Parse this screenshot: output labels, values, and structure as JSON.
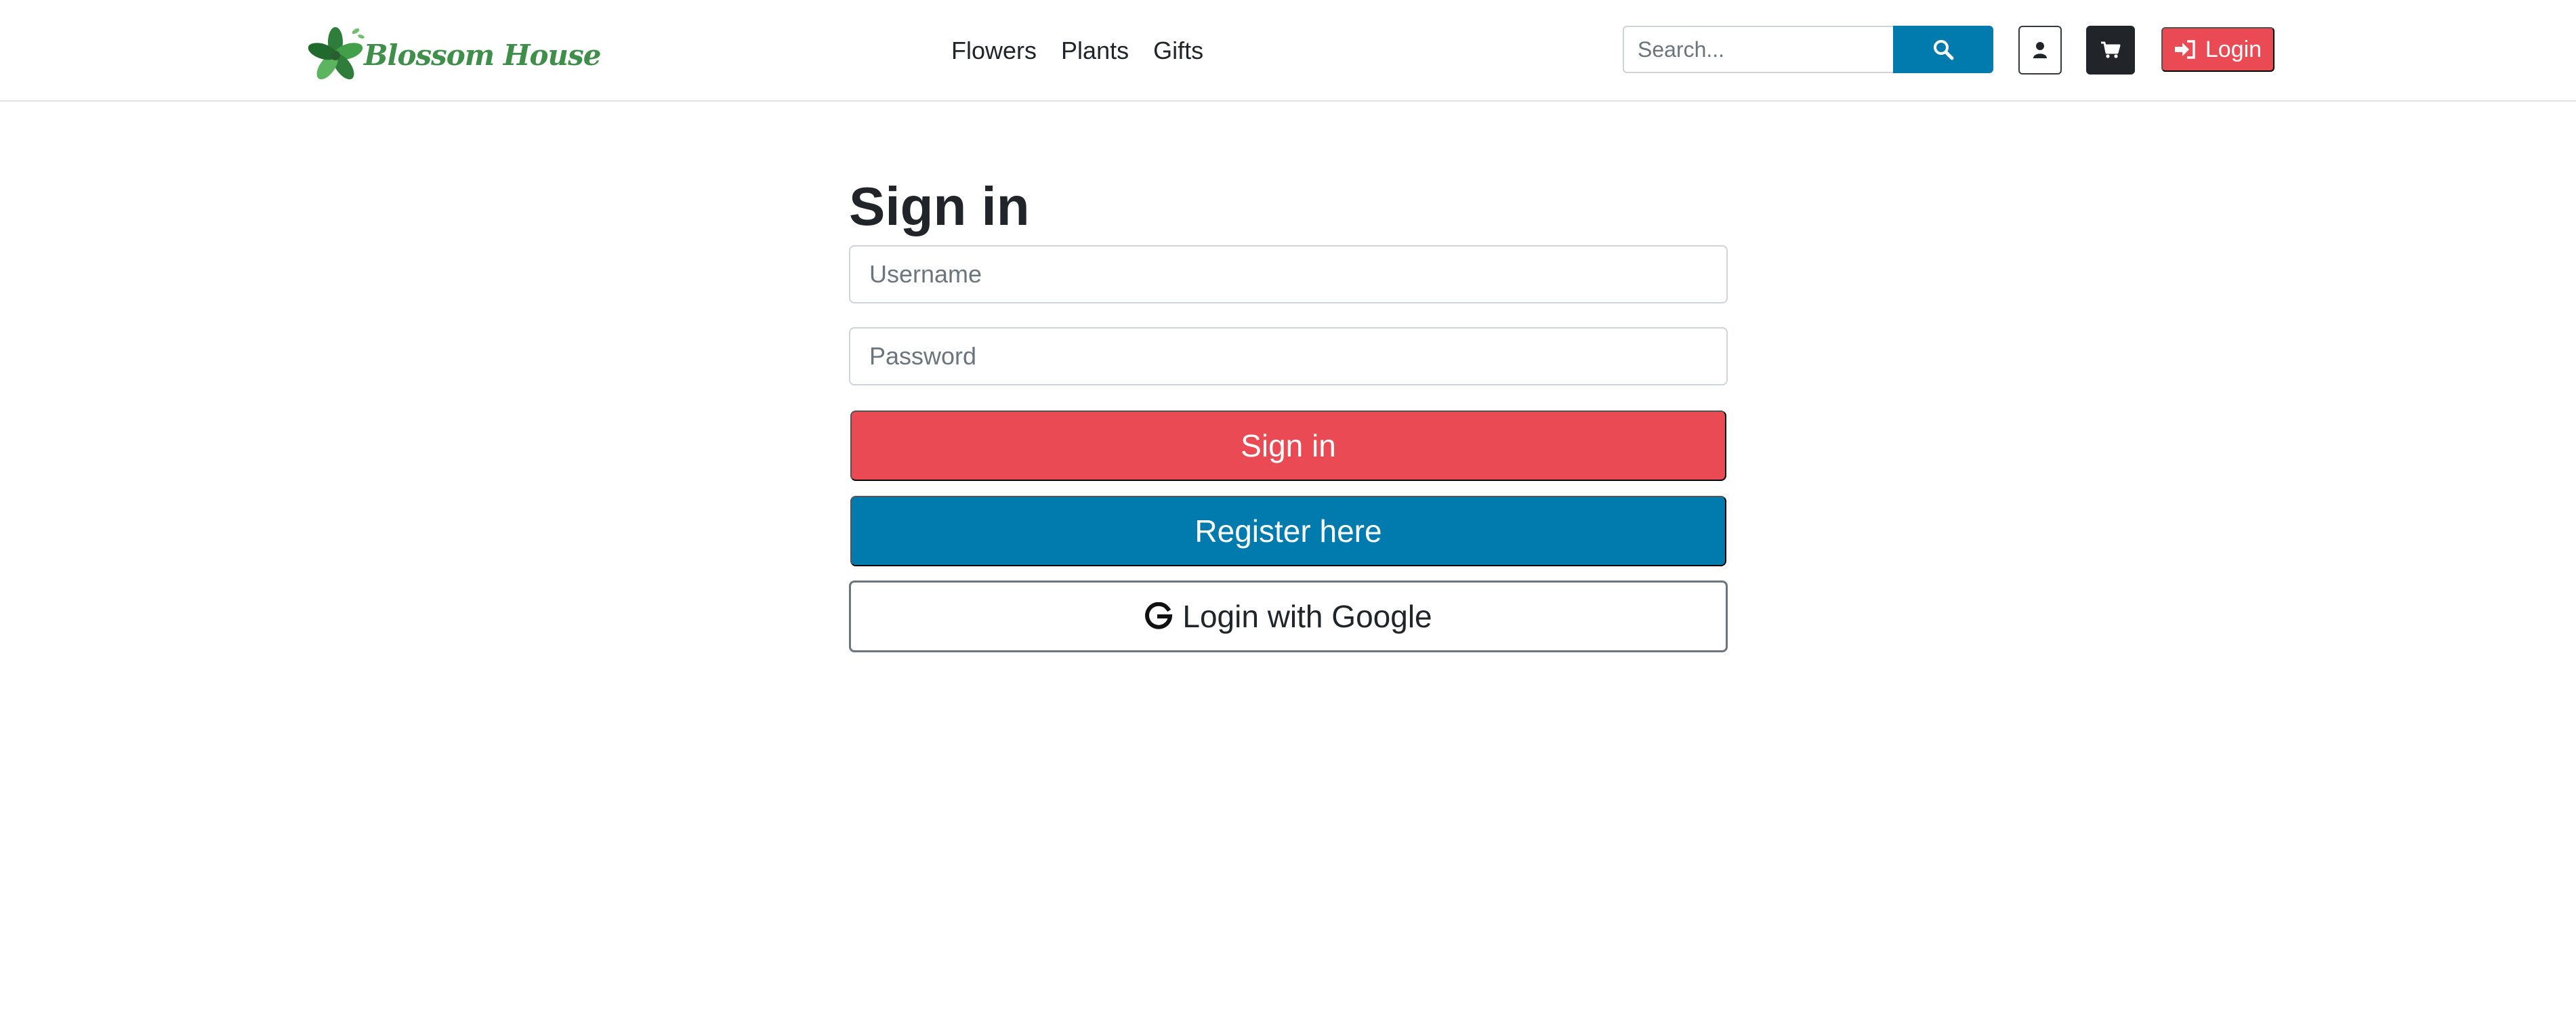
{
  "brand": {
    "name": "Blossom House",
    "color": "#3f8f4a",
    "icon": "flower-leaves-icon"
  },
  "nav": {
    "links": [
      "Flowers",
      "Plants",
      "Gifts"
    ]
  },
  "search": {
    "placeholder": "Search...",
    "icon": "search-icon"
  },
  "header_buttons": {
    "user_icon": "user-icon",
    "cart_icon": "cart-icon",
    "login_label": "Login",
    "login_icon": "sign-in-icon"
  },
  "signin": {
    "title": "Sign in",
    "username_placeholder": "Username",
    "password_placeholder": "Password",
    "signin_label": "Sign in",
    "register_label": "Register here",
    "google_label": "Login with Google",
    "google_icon": "google-icon"
  },
  "colors": {
    "primary_red": "#ea4a53",
    "primary_blue": "#017bad",
    "dark": "#212529"
  }
}
